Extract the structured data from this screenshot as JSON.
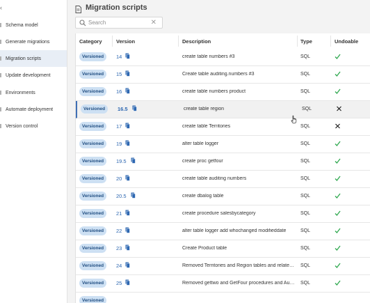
{
  "sidebar": {
    "items": [
      {
        "label": "Schema model"
      },
      {
        "label": "Generate migrations"
      },
      {
        "label": "Migration scripts",
        "active": true
      },
      {
        "label": "Update development"
      },
      {
        "label": "Environments"
      },
      {
        "label": "Automate deployment"
      },
      {
        "label": "Version control"
      }
    ]
  },
  "header": {
    "title": "Migration scripts"
  },
  "search": {
    "placeholder": "Search",
    "value": ""
  },
  "table": {
    "columns": [
      "Category",
      "Version",
      "Description",
      "Type",
      "Undoable"
    ],
    "rows": [
      {
        "category": "Versioned",
        "version": "14",
        "description": "create table numbers #3",
        "type": "SQL",
        "undoable": "check"
      },
      {
        "category": "Versioned",
        "version": "15",
        "description": "Create table auditing.numbers #3",
        "type": "SQL",
        "undoable": "check"
      },
      {
        "category": "Versioned",
        "version": "16",
        "description": "create table numbers product",
        "type": "SQL",
        "undoable": "check"
      },
      {
        "category": "Versioned",
        "version": "16.5",
        "description": "create table region",
        "type": "SQL",
        "undoable": "cross",
        "highlight": true
      },
      {
        "category": "Versioned",
        "version": "17",
        "description": "create table Territories",
        "type": "SQL",
        "undoable": "cross"
      },
      {
        "category": "Versioned",
        "version": "19",
        "description": "alter table logger",
        "type": "SQL",
        "undoable": "check"
      },
      {
        "category": "Versioned",
        "version": "19.5",
        "description": "create proc getfour",
        "type": "SQL",
        "undoable": "check"
      },
      {
        "category": "Versioned",
        "version": "20",
        "description": "create table auditing numbers",
        "type": "SQL",
        "undoable": "check"
      },
      {
        "category": "Versioned",
        "version": "20.5",
        "description": "create dbalog table",
        "type": "SQL",
        "undoable": "check"
      },
      {
        "category": "Versioned",
        "version": "21",
        "description": "create procedure salesbycategory",
        "type": "SQL",
        "undoable": "check"
      },
      {
        "category": "Versioned",
        "version": "22",
        "description": "alter table logger add whochanged modifieddate",
        "type": "SQL",
        "undoable": "check"
      },
      {
        "category": "Versioned",
        "version": "23",
        "description": "Create Product table",
        "type": "SQL",
        "undoable": "check"
      },
      {
        "category": "Versioned",
        "version": "24",
        "description": "Removed Territories and Region tables and related ...",
        "type": "SQL",
        "undoable": "check"
      },
      {
        "category": "Versioned",
        "version": "25",
        "description": "Removed gettwo and GetFour procedures and Audi...",
        "type": "SQL",
        "undoable": "check"
      },
      {
        "category": "Versioned",
        "version": "",
        "description": "",
        "type": "",
        "undoable": ""
      }
    ]
  },
  "colors": {
    "accent": "#2d67b1",
    "badge_bg": "#cde0f3",
    "check": "#2fa84f",
    "cross": "#222222"
  },
  "icons": {
    "title": "document-icon",
    "search": "search-icon",
    "clear": "close-icon",
    "version": "script-file-icon"
  }
}
